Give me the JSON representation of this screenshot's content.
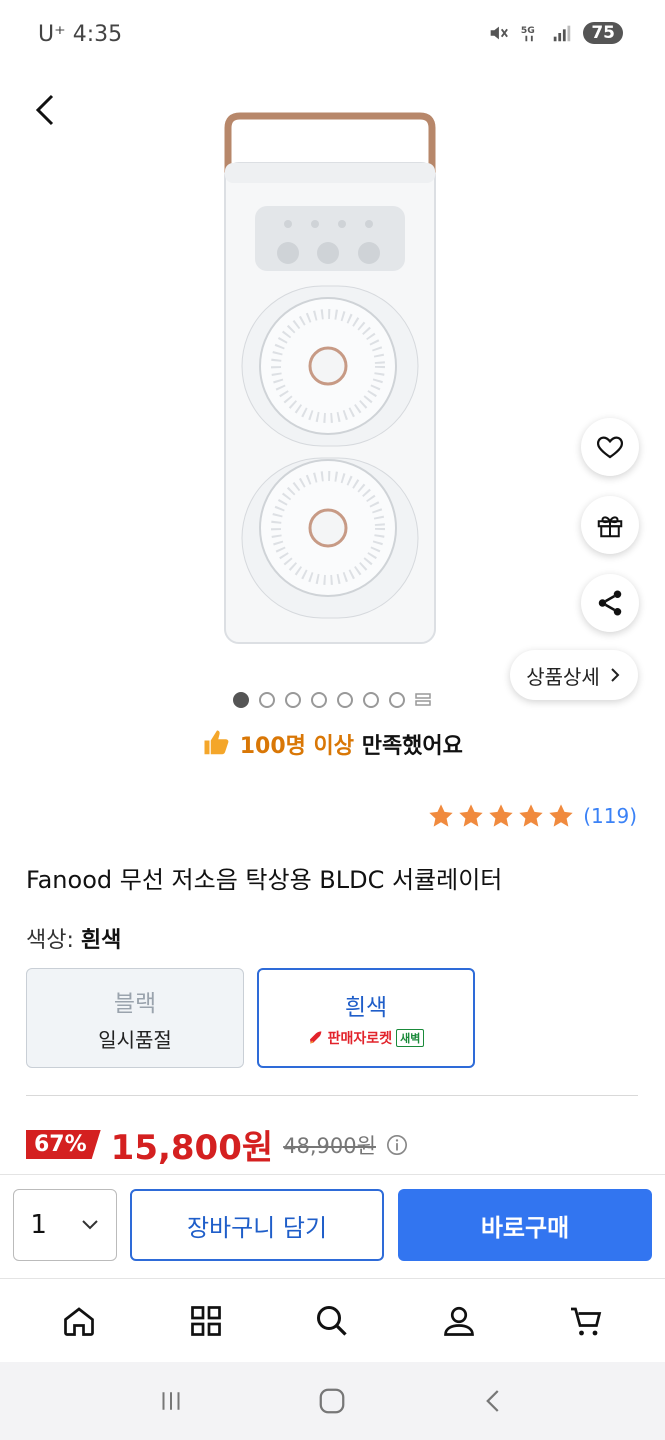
{
  "status_bar": {
    "carrier": "U⁺ 4:35",
    "battery": "75"
  },
  "product": {
    "satisfaction_prefix": "100명 이상",
    "satisfaction_suffix": " 만족했어요",
    "rating_count": "(119)",
    "title": "Fanood 무선 저소음 탁상용 BLDC 서큘레이터",
    "detail_label": "상품상세",
    "image_count_dots": 7
  },
  "color_option": {
    "label": "색상:",
    "selected_value": "흰색",
    "options": [
      {
        "name": "블랙",
        "sub": "일시품절"
      },
      {
        "name": "흰색",
        "delivery": "판매자로켓",
        "badge": "새벽"
      }
    ]
  },
  "price": {
    "discount": "67%",
    "sale": "15,800원",
    "original": "48,900원"
  },
  "buy_bar": {
    "quantity": "1",
    "cart_label": "장바구니 담기",
    "buy_label": "바로구매"
  },
  "tabs": [
    "home-icon",
    "category-icon",
    "search-icon",
    "my-icon",
    "cart-icon"
  ],
  "colors": {
    "accent": "#3275f0",
    "price_red": "#d42020",
    "rating_orange": "#f08a3e"
  }
}
